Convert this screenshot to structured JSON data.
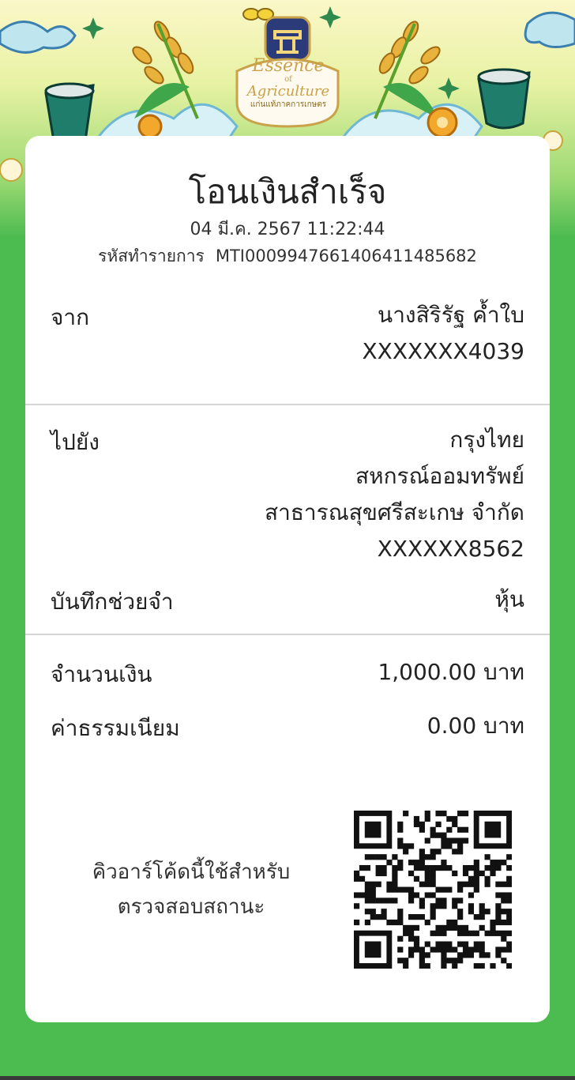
{
  "banner": {
    "logo_line1": "Essence",
    "logo_of": "of",
    "logo_line2": "Agriculture",
    "logo_sub": "แก่นแท้ภาคการเกษตร"
  },
  "receipt": {
    "title": "โอนเงินสำเร็จ",
    "datetime": "04 มี.ค. 2567 11:22:44",
    "txn_label": "รหัสทำรายการ",
    "txn_id": "MTI000994766140641148568​2",
    "from_label": "จาก",
    "from_name": "นางสิริรัฐ ค้ำใบ",
    "from_account": "XXXXXXX4039",
    "to_label": "ไปยัง",
    "to_bank": "กรุงไทย",
    "to_name_line1": "สหกรณ์ออมทรัพย์",
    "to_name_line2": "สาธารณสุขศรีสะเกษ จำกัด",
    "to_account": "XXXXXX8562",
    "memo_label": "บันทึกช่วยจำ",
    "memo_value": "หุ้น",
    "amount_label": "จำนวนเงิน",
    "amount_value": "1,000.00 บาท",
    "fee_label": "ค่าธรรมเนียม",
    "fee_value": "0.00 บาท",
    "qr_caption_line1": "คิวอาร์โค้ดนี้ใช้สำหรับ",
    "qr_caption_line2": "ตรวจสอบสถานะ"
  },
  "colors": {
    "background_green": "#4cbb50",
    "card": "#ffffff",
    "text": "#222222",
    "divider": "#d6d6d6",
    "logo_gold": "#c9a24a",
    "logo_navy": "#2b3a78"
  }
}
